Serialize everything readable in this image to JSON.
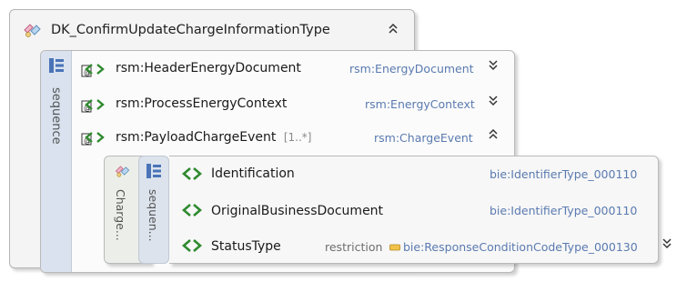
{
  "outer": {
    "title": "DK_ConfirmUpdateChargeInformationType",
    "collapse_icon": "double-chevron-up-icon",
    "type_icon": "complex-type-icon"
  },
  "sequence": {
    "label": "sequence",
    "elements": [
      {
        "name": "rsm:HeaderEnergyDocument",
        "type": "rsm:EnergyDocument",
        "cardinality": "",
        "expand_icon": "double-chevron-down-icon"
      },
      {
        "name": "rsm:ProcessEnergyContext",
        "type": "rsm:EnergyContext",
        "cardinality": "",
        "expand_icon": "double-chevron-down-icon"
      },
      {
        "name": "rsm:PayloadChargeEvent",
        "type": "rsm:ChargeEvent",
        "cardinality": "[1..*]",
        "expand_icon": "double-chevron-up-icon"
      }
    ]
  },
  "nested": {
    "complex_label": "Charge...",
    "sequence_label": "sequen...",
    "elements": [
      {
        "name": "Identification",
        "type": "bie:IdentifierType_000110",
        "derivation": ""
      },
      {
        "name": "OriginalBusinessDocument",
        "type": "bie:IdentifierType_000110",
        "derivation": ""
      },
      {
        "name": "StatusType",
        "type": "bie:ResponseConditionCodeType_000130",
        "derivation": "restriction",
        "expand_icon": "double-chevron-down-icon"
      }
    ]
  },
  "colors": {
    "type_text": "#5a7ab0",
    "sequence_side": "#d9e2ee",
    "element_icon": "#3a8a3a"
  }
}
